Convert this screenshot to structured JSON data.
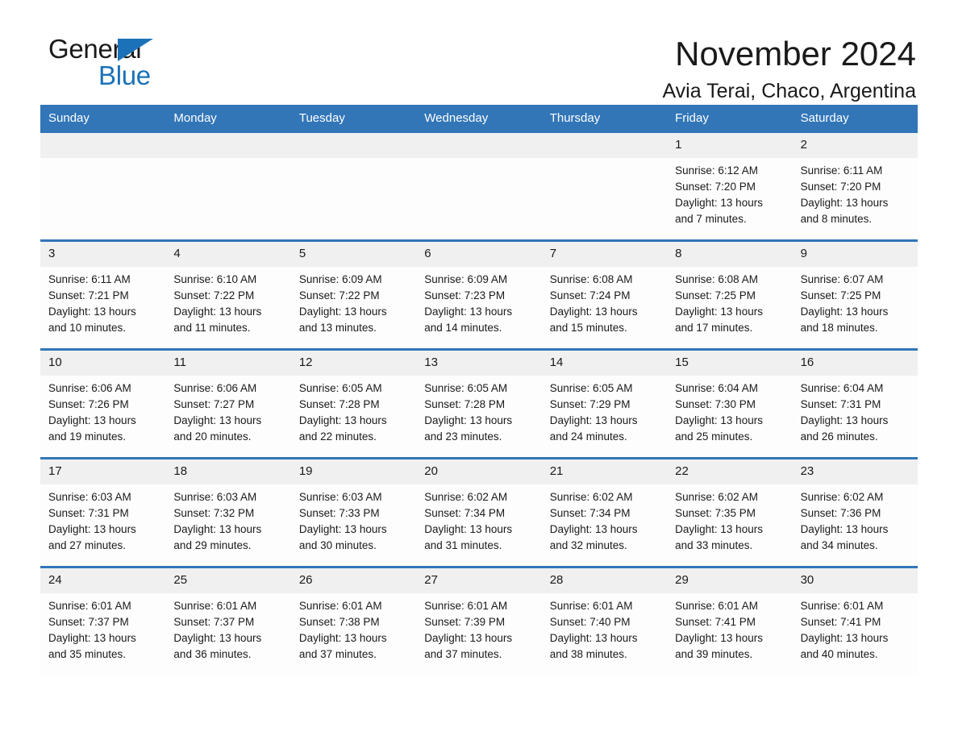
{
  "logo": {
    "word1": "General",
    "word2": "Blue",
    "accent_color": "#1b72b8",
    "triangle_icon": "triangle-icon"
  },
  "header": {
    "month_title": "November 2024",
    "location": "Avia Terai, Chaco, Argentina"
  },
  "calendar": {
    "header_color": "#3276b8",
    "weekdays": [
      "Sunday",
      "Monday",
      "Tuesday",
      "Wednesday",
      "Thursday",
      "Friday",
      "Saturday"
    ],
    "weeks": [
      [
        {
          "day": "",
          "sunrise": "",
          "sunset": "",
          "daylight1": "",
          "daylight2": ""
        },
        {
          "day": "",
          "sunrise": "",
          "sunset": "",
          "daylight1": "",
          "daylight2": ""
        },
        {
          "day": "",
          "sunrise": "",
          "sunset": "",
          "daylight1": "",
          "daylight2": ""
        },
        {
          "day": "",
          "sunrise": "",
          "sunset": "",
          "daylight1": "",
          "daylight2": ""
        },
        {
          "day": "",
          "sunrise": "",
          "sunset": "",
          "daylight1": "",
          "daylight2": ""
        },
        {
          "day": "1",
          "sunrise": "Sunrise: 6:12 AM",
          "sunset": "Sunset: 7:20 PM",
          "daylight1": "Daylight: 13 hours",
          "daylight2": "and 7 minutes."
        },
        {
          "day": "2",
          "sunrise": "Sunrise: 6:11 AM",
          "sunset": "Sunset: 7:20 PM",
          "daylight1": "Daylight: 13 hours",
          "daylight2": "and 8 minutes."
        }
      ],
      [
        {
          "day": "3",
          "sunrise": "Sunrise: 6:11 AM",
          "sunset": "Sunset: 7:21 PM",
          "daylight1": "Daylight: 13 hours",
          "daylight2": "and 10 minutes."
        },
        {
          "day": "4",
          "sunrise": "Sunrise: 6:10 AM",
          "sunset": "Sunset: 7:22 PM",
          "daylight1": "Daylight: 13 hours",
          "daylight2": "and 11 minutes."
        },
        {
          "day": "5",
          "sunrise": "Sunrise: 6:09 AM",
          "sunset": "Sunset: 7:22 PM",
          "daylight1": "Daylight: 13 hours",
          "daylight2": "and 13 minutes."
        },
        {
          "day": "6",
          "sunrise": "Sunrise: 6:09 AM",
          "sunset": "Sunset: 7:23 PM",
          "daylight1": "Daylight: 13 hours",
          "daylight2": "and 14 minutes."
        },
        {
          "day": "7",
          "sunrise": "Sunrise: 6:08 AM",
          "sunset": "Sunset: 7:24 PM",
          "daylight1": "Daylight: 13 hours",
          "daylight2": "and 15 minutes."
        },
        {
          "day": "8",
          "sunrise": "Sunrise: 6:08 AM",
          "sunset": "Sunset: 7:25 PM",
          "daylight1": "Daylight: 13 hours",
          "daylight2": "and 17 minutes."
        },
        {
          "day": "9",
          "sunrise": "Sunrise: 6:07 AM",
          "sunset": "Sunset: 7:25 PM",
          "daylight1": "Daylight: 13 hours",
          "daylight2": "and 18 minutes."
        }
      ],
      [
        {
          "day": "10",
          "sunrise": "Sunrise: 6:06 AM",
          "sunset": "Sunset: 7:26 PM",
          "daylight1": "Daylight: 13 hours",
          "daylight2": "and 19 minutes."
        },
        {
          "day": "11",
          "sunrise": "Sunrise: 6:06 AM",
          "sunset": "Sunset: 7:27 PM",
          "daylight1": "Daylight: 13 hours",
          "daylight2": "and 20 minutes."
        },
        {
          "day": "12",
          "sunrise": "Sunrise: 6:05 AM",
          "sunset": "Sunset: 7:28 PM",
          "daylight1": "Daylight: 13 hours",
          "daylight2": "and 22 minutes."
        },
        {
          "day": "13",
          "sunrise": "Sunrise: 6:05 AM",
          "sunset": "Sunset: 7:28 PM",
          "daylight1": "Daylight: 13 hours",
          "daylight2": "and 23 minutes."
        },
        {
          "day": "14",
          "sunrise": "Sunrise: 6:05 AM",
          "sunset": "Sunset: 7:29 PM",
          "daylight1": "Daylight: 13 hours",
          "daylight2": "and 24 minutes."
        },
        {
          "day": "15",
          "sunrise": "Sunrise: 6:04 AM",
          "sunset": "Sunset: 7:30 PM",
          "daylight1": "Daylight: 13 hours",
          "daylight2": "and 25 minutes."
        },
        {
          "day": "16",
          "sunrise": "Sunrise: 6:04 AM",
          "sunset": "Sunset: 7:31 PM",
          "daylight1": "Daylight: 13 hours",
          "daylight2": "and 26 minutes."
        }
      ],
      [
        {
          "day": "17",
          "sunrise": "Sunrise: 6:03 AM",
          "sunset": "Sunset: 7:31 PM",
          "daylight1": "Daylight: 13 hours",
          "daylight2": "and 27 minutes."
        },
        {
          "day": "18",
          "sunrise": "Sunrise: 6:03 AM",
          "sunset": "Sunset: 7:32 PM",
          "daylight1": "Daylight: 13 hours",
          "daylight2": "and 29 minutes."
        },
        {
          "day": "19",
          "sunrise": "Sunrise: 6:03 AM",
          "sunset": "Sunset: 7:33 PM",
          "daylight1": "Daylight: 13 hours",
          "daylight2": "and 30 minutes."
        },
        {
          "day": "20",
          "sunrise": "Sunrise: 6:02 AM",
          "sunset": "Sunset: 7:34 PM",
          "daylight1": "Daylight: 13 hours",
          "daylight2": "and 31 minutes."
        },
        {
          "day": "21",
          "sunrise": "Sunrise: 6:02 AM",
          "sunset": "Sunset: 7:34 PM",
          "daylight1": "Daylight: 13 hours",
          "daylight2": "and 32 minutes."
        },
        {
          "day": "22",
          "sunrise": "Sunrise: 6:02 AM",
          "sunset": "Sunset: 7:35 PM",
          "daylight1": "Daylight: 13 hours",
          "daylight2": "and 33 minutes."
        },
        {
          "day": "23",
          "sunrise": "Sunrise: 6:02 AM",
          "sunset": "Sunset: 7:36 PM",
          "daylight1": "Daylight: 13 hours",
          "daylight2": "and 34 minutes."
        }
      ],
      [
        {
          "day": "24",
          "sunrise": "Sunrise: 6:01 AM",
          "sunset": "Sunset: 7:37 PM",
          "daylight1": "Daylight: 13 hours",
          "daylight2": "and 35 minutes."
        },
        {
          "day": "25",
          "sunrise": "Sunrise: 6:01 AM",
          "sunset": "Sunset: 7:37 PM",
          "daylight1": "Daylight: 13 hours",
          "daylight2": "and 36 minutes."
        },
        {
          "day": "26",
          "sunrise": "Sunrise: 6:01 AM",
          "sunset": "Sunset: 7:38 PM",
          "daylight1": "Daylight: 13 hours",
          "daylight2": "and 37 minutes."
        },
        {
          "day": "27",
          "sunrise": "Sunrise: 6:01 AM",
          "sunset": "Sunset: 7:39 PM",
          "daylight1": "Daylight: 13 hours",
          "daylight2": "and 37 minutes."
        },
        {
          "day": "28",
          "sunrise": "Sunrise: 6:01 AM",
          "sunset": "Sunset: 7:40 PM",
          "daylight1": "Daylight: 13 hours",
          "daylight2": "and 38 minutes."
        },
        {
          "day": "29",
          "sunrise": "Sunrise: 6:01 AM",
          "sunset": "Sunset: 7:41 PM",
          "daylight1": "Daylight: 13 hours",
          "daylight2": "and 39 minutes."
        },
        {
          "day": "30",
          "sunrise": "Sunrise: 6:01 AM",
          "sunset": "Sunset: 7:41 PM",
          "daylight1": "Daylight: 13 hours",
          "daylight2": "and 40 minutes."
        }
      ]
    ]
  }
}
